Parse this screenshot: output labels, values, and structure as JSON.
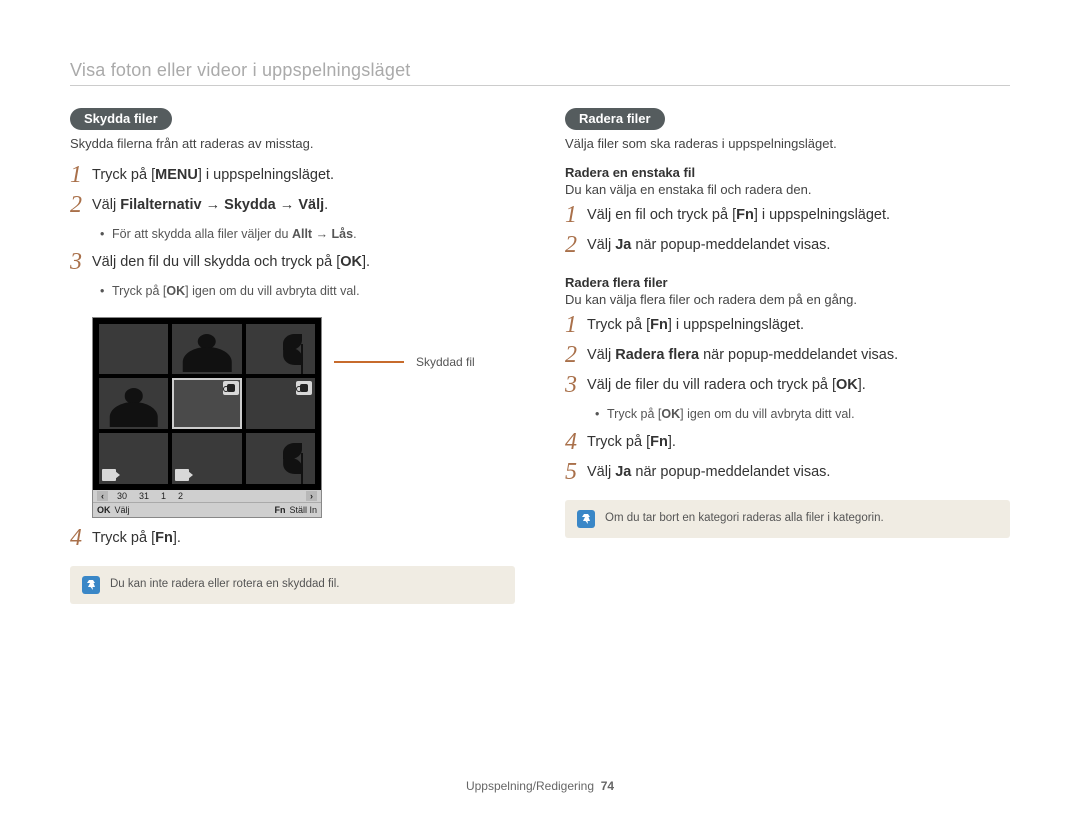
{
  "header": {
    "title": "Visa foton eller videor i uppspelningsläget"
  },
  "left": {
    "pill": "Skydda filer",
    "intro": "Skydda filerna från att raderas av misstag.",
    "steps": {
      "s1_pre": "Tryck på [",
      "s1_glyph": "MENU",
      "s1_post": "] i uppspelningsläget.",
      "s2_a": "Välj ",
      "s2_b": "Filalternativ",
      "s2_c": "Skydda",
      "s2_d": "Välj",
      "s2_arrow": " → ",
      "s2_end": ".",
      "bul1_a": "För att skydda alla filer väljer du ",
      "bul1_b": "Allt",
      "bul1_c": "Lås",
      "bul1_arrow": " → ",
      "bul1_end": ".",
      "s3_pre": "Välj den fil du vill skydda och tryck på [",
      "s3_glyph": "OK",
      "s3_post": "].",
      "bul2_a": "Tryck på [",
      "bul2_glyph": "OK",
      "bul2_b": "] igen om du vill avbryta ditt val.",
      "s4_pre": "Tryck på [",
      "s4_glyph": "Fn",
      "s4_post": "]."
    },
    "note": "Du kan inte radera eller rotera en skyddad fil.",
    "fig": {
      "callout": "Skyddad fil",
      "dates": {
        "navL": "‹",
        "d1": "30",
        "d2": "31",
        "d3": "1",
        "d4": "2",
        "navR": "›"
      },
      "foot": {
        "okGlyph": "OK",
        "okLabel": "Välj",
        "fnGlyph": "Fn",
        "fnLabel": "Ställ In"
      }
    }
  },
  "right": {
    "pill": "Radera filer",
    "intro": "Välja filer som ska raderas i uppspelningsläget.",
    "sec1_title": "Radera en enstaka fil",
    "sec1_desc": "Du kan välja en enstaka fil och radera den.",
    "sec1_s1_pre": "Välj en fil och tryck på [",
    "sec1_s1_glyph": "Fn",
    "sec1_s1_post": "] i uppspelningsläget.",
    "sec1_s2_a": "Välj ",
    "sec1_s2_b": "Ja",
    "sec1_s2_c": " när popup-meddelandet visas.",
    "sec2_title": "Radera flera filer",
    "sec2_desc": "Du kan välja flera filer och radera dem på en gång.",
    "sec2_s1_pre": "Tryck på [",
    "sec2_s1_glyph": "Fn",
    "sec2_s1_post": "] i uppspelningsläget.",
    "sec2_s2_a": "Välj ",
    "sec2_s2_b": "Radera flera",
    "sec2_s2_c": " när popup-meddelandet visas.",
    "sec2_s3_pre": "Välj de filer du vill radera och tryck på [",
    "sec2_s3_glyph": "OK",
    "sec2_s3_post": "].",
    "sec2_bul_a": "Tryck på [",
    "sec2_bul_glyph": "OK",
    "sec2_bul_b": "] igen om du vill avbryta ditt val.",
    "sec2_s4_pre": "Tryck på [",
    "sec2_s4_glyph": "Fn",
    "sec2_s4_post": "].",
    "sec2_s5_a": "Välj ",
    "sec2_s5_b": "Ja",
    "sec2_s5_c": " när popup-meddelandet visas.",
    "note": "Om du tar bort en kategori raderas alla filer i kategorin."
  },
  "footer": {
    "section": "Uppspelning/Redigering",
    "page": "74"
  },
  "nums": {
    "n1": "1",
    "n2": "2",
    "n3": "3",
    "n4": "4",
    "n5": "5"
  }
}
